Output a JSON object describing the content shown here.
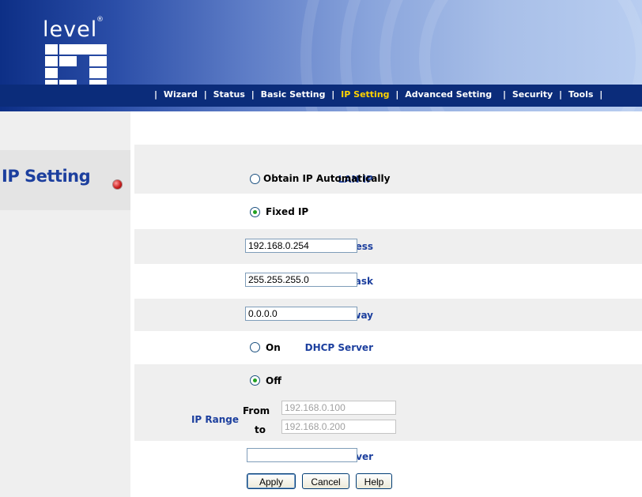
{
  "logo": {
    "top_text": "level",
    "registered": "®",
    "bottom_text": "one"
  },
  "nav": {
    "items": [
      {
        "label": "Wizard",
        "active": false
      },
      {
        "label": "Status",
        "active": false
      },
      {
        "label": "Basic Setting",
        "active": false
      },
      {
        "label": "IP Setting",
        "active": true
      },
      {
        "label": "Advanced Setting",
        "active": false
      },
      {
        "label": "Security",
        "active": false
      },
      {
        "label": "Tools",
        "active": false
      }
    ],
    "separator": "|"
  },
  "page": {
    "title": "IP Setting"
  },
  "form": {
    "lan_ip": {
      "label": "LAN IP",
      "option_auto": "Obtain IP Automatically",
      "option_fixed": "Fixed IP",
      "selected": "fixed"
    },
    "address": {
      "label": "Address",
      "value": "192.168.0.254"
    },
    "subnet_mask": {
      "label": "Subnet Mask",
      "value": "255.255.255.0"
    },
    "gateway": {
      "label": "Gateway",
      "value": "0.0.0.0"
    },
    "dhcp_server": {
      "label": "DHCP Server",
      "option_on": "On",
      "option_off": "Off",
      "selected": "off"
    },
    "ip_range": {
      "label": "IP Range",
      "from_label": "From",
      "from_value": "192.168.0.100",
      "to_label": "to",
      "to_value": "192.168.0.200",
      "disabled": true
    },
    "dns_server": {
      "label": "DNS Server",
      "value": ""
    }
  },
  "buttons": {
    "apply": "Apply",
    "cancel": "Cancel",
    "help": "Help"
  },
  "colors": {
    "header_dark": "#0b2c7a",
    "nav_active": "#ffd200",
    "label_blue": "#1c3f9e",
    "row_shade": "#efefef"
  }
}
